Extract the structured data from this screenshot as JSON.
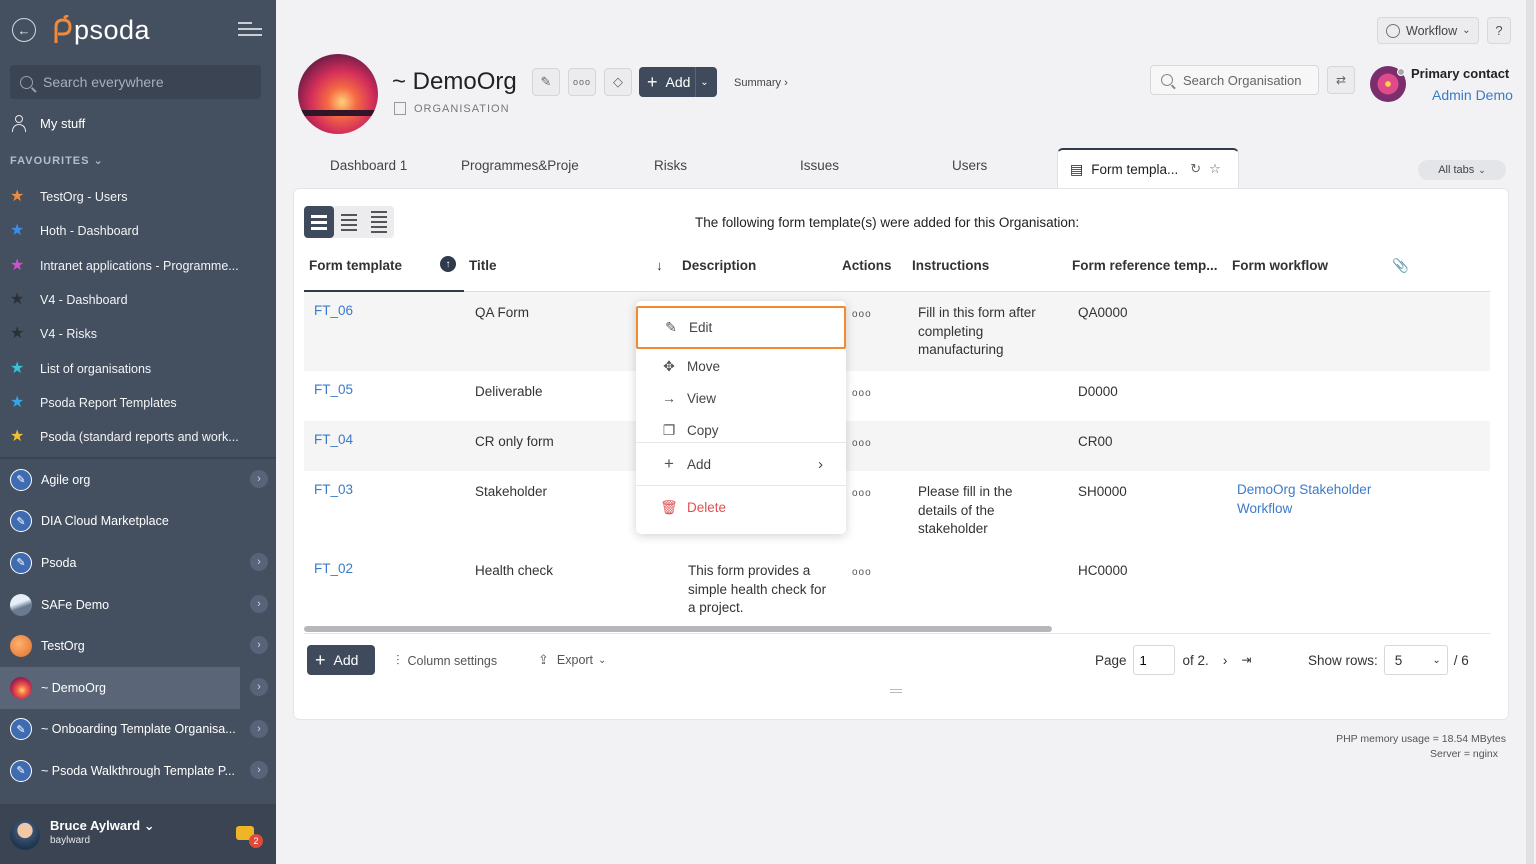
{
  "sidebar": {
    "logo": "psoda",
    "search_placeholder": "Search everywhere",
    "my_stuff": "My stuff",
    "favourites_heading": "FAVOURITES",
    "favourites": [
      {
        "label": "TestOrg - Users",
        "color": "#f08a3c"
      },
      {
        "label": "Hoth - Dashboard",
        "color": "#3a8ee6"
      },
      {
        "label": "Intranet applications - Programme...",
        "color": "#d24fd2"
      },
      {
        "label": "V4 - Dashboard",
        "color": "#2a2f38"
      },
      {
        "label": "V4 - Risks",
        "color": "#2a2f38"
      },
      {
        "label": "List of organisations",
        "color": "#38c4d8"
      },
      {
        "label": "Psoda Report Templates",
        "color": "#38a6e6"
      },
      {
        "label": "Psoda (standard reports and work...",
        "color": "#f0c030"
      }
    ],
    "orgs": [
      {
        "label": "Agile org",
        "icon": "compass-icon"
      },
      {
        "label": "DIA Cloud Marketplace",
        "icon": "compass-icon"
      },
      {
        "label": "Psoda",
        "icon": "compass-icon"
      },
      {
        "label": "SAFe Demo",
        "icon": "landscape-avatar"
      },
      {
        "label": "TestOrg",
        "icon": "orange-avatar"
      },
      {
        "label": "~ DemoOrg",
        "icon": "sunset-avatar"
      },
      {
        "label": "~ Onboarding Template Organisa...",
        "icon": "compass-icon"
      },
      {
        "label": "~ Psoda Walkthrough Template P...",
        "icon": "compass-icon"
      }
    ],
    "user": {
      "name": "Bruce Aylward",
      "handle": "baylward",
      "notifications": "2"
    }
  },
  "header": {
    "workflow": "Workflow",
    "help": "?",
    "org_title": "~ DemoOrg",
    "org_type": "ORGANISATION",
    "add": "Add",
    "summary": "Summary ›",
    "search_placeholder": "Search Organisation",
    "primary_contact_label": "Primary contact",
    "primary_contact_name": "Admin Demo"
  },
  "tabs": [
    "Dashboard 1",
    "Programmes&Proje",
    "Risks",
    "Issues",
    "Users",
    "Form templa..."
  ],
  "all_tabs": "All tabs",
  "panel": {
    "intro": "The following form template(s) were added for this Organisation:",
    "columns": [
      "Form template",
      "Title",
      "Description",
      "Actions",
      "Instructions",
      "Form reference temp...",
      "Form workflow"
    ],
    "rows": [
      {
        "id": "FT_06",
        "title": "QA Form",
        "desc": "",
        "actions": "ooo",
        "instructions": "Fill in this form after completing manufacturing",
        "ref": "QA0000",
        "workflow": ""
      },
      {
        "id": "FT_05",
        "title": "Deliverable",
        "desc": "",
        "actions": "ooo",
        "instructions": "",
        "ref": "D0000",
        "workflow": ""
      },
      {
        "id": "FT_04",
        "title": "CR only form",
        "desc": "",
        "actions": "ooo",
        "instructions": "",
        "ref": "CR00",
        "workflow": ""
      },
      {
        "id": "FT_03",
        "title": "Stakeholder",
        "desc": "",
        "actions": "ooo",
        "instructions": "Please fill in the details of the stakeholder",
        "ref": "SH0000",
        "workflow": "DemoOrg Stakeholder Workflow"
      },
      {
        "id": "FT_02",
        "title": "Health check",
        "desc": "This form provides a simple health check for a project.",
        "actions": "ooo",
        "instructions": "",
        "ref": "HC0000",
        "workflow": ""
      }
    ],
    "footer": {
      "add": "Add",
      "column_settings": "Column settings",
      "export": "Export",
      "page_label": "Page",
      "page_value": "1",
      "of_pages": "of 2.",
      "show_rows_label": "Show rows:",
      "rows_value": "5",
      "total": "/ 6"
    }
  },
  "context_menu": {
    "edit": "Edit",
    "move": "Move",
    "view": "View",
    "copy": "Copy",
    "add": "Add",
    "delete": "Delete"
  },
  "page_footer": {
    "memory": "PHP memory usage = 18.54 MBytes",
    "server": "Server = nginx"
  }
}
